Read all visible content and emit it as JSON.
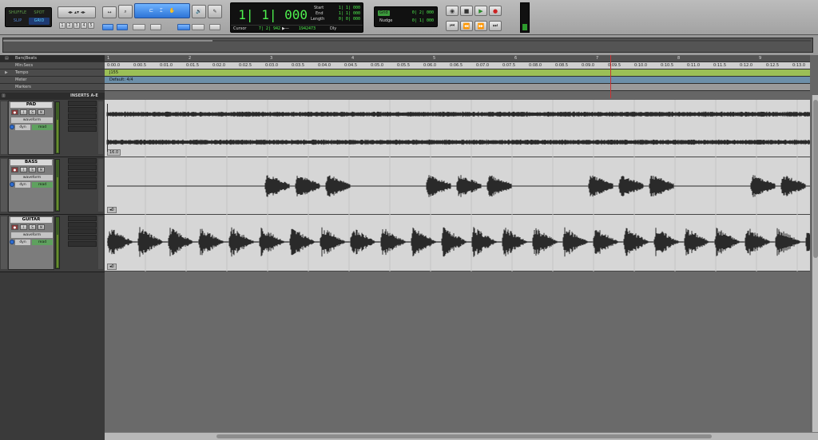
{
  "toolbar": {
    "modes": {
      "shuffle": "SHUFFLE",
      "spot": "SPOT",
      "slip": "SLIP",
      "grid": "GRID"
    },
    "zoom_presets": [
      "1",
      "2",
      "3",
      "4",
      "5"
    ],
    "counter": {
      "main": "1| 1| 000",
      "start_label": "Start",
      "start_value": "1| 1| 000",
      "end_label": "End",
      "end_value": "1| 1| 000",
      "length_label": "Length",
      "length_value": "0| 0| 000",
      "cursor_label": "Cursor",
      "cursor_value": "7| 2| 942",
      "sample_value": "1942473",
      "dly_label": "Dly"
    },
    "grid_label": "Grid",
    "grid_value": "0| 2| 000",
    "nudge_label": "Nudge",
    "nudge_value": "0| 1| 000",
    "transport_icons": [
      "online-icon",
      "stop-icon",
      "play-icon",
      "record-icon",
      "return-to-zero-icon",
      "rewind-icon",
      "fast-forward-icon",
      "go-to-end-icon"
    ]
  },
  "rulers": {
    "names": [
      "Bars|Beats",
      "Min:Secs",
      "Tempo",
      "Meter",
      "Markers"
    ],
    "bars": [
      "1",
      "2",
      "3",
      "4",
      "5",
      "6",
      "7",
      "8",
      "9"
    ],
    "minsecs": [
      "0:00.0",
      "0:00.5",
      "0:01.0",
      "0:01.5",
      "0:02.0",
      "0:02.5",
      "0:03.0",
      "0:03.5",
      "0:04.0",
      "0:04.5",
      "0:05.0",
      "0:05.5",
      "0:06.0",
      "0:06.5",
      "0:07.0",
      "0:07.5",
      "0:08.0",
      "0:08.5",
      "0:09.0",
      "0:09.5",
      "0:10.0",
      "0:10.5",
      "0:11.0",
      "0:11.5",
      "0:12.0",
      "0:12.5",
      "0:13.0"
    ],
    "tempo_value": "J155",
    "meter_value": "Default: 4/4"
  },
  "inserts_header": "INSERTS A-E",
  "tracks": [
    {
      "name": "PAD",
      "view": "waveform",
      "dyn": "dyn",
      "automation": "read",
      "clip_label": "16.0"
    },
    {
      "name": "BASS",
      "view": "waveform",
      "dyn": "dyn",
      "automation": "read",
      "clip_label": ""
    },
    {
      "name": "GUITAR",
      "view": "waveform",
      "dyn": "dyn",
      "automation": "read",
      "clip_label": ""
    }
  ],
  "colors": {
    "counter_green": "#4ef04e",
    "tempo_ruler": "#9bbf57",
    "meter_ruler": "#6c8fa9",
    "selection_blue": "#2d74d6",
    "playhead_red": "#cc3333"
  }
}
